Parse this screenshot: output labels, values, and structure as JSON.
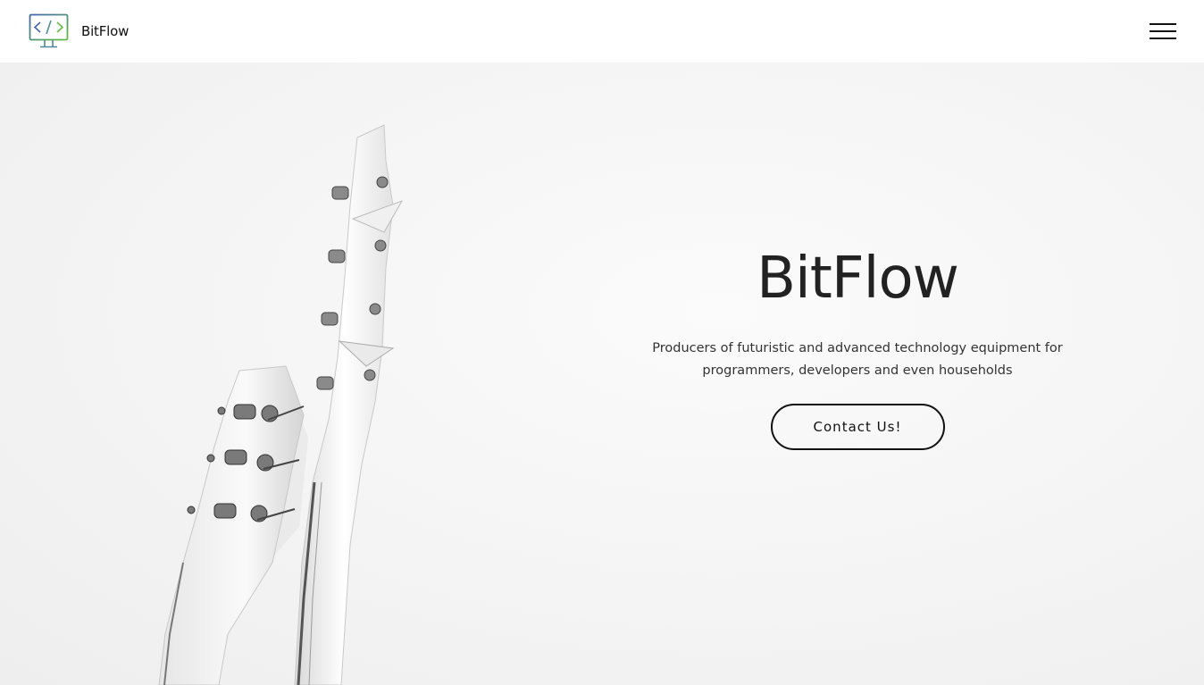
{
  "navbar": {
    "brand_name": "BitFlow",
    "logo_icon": "monitor-code-icon",
    "menu_icon": "hamburger-menu-icon"
  },
  "hero": {
    "title": "BitFlow",
    "subtitle": "Producers of futuristic and advanced technology equipment for programmers, developers and even households",
    "cta_label": "Contact Us!",
    "image_subject": "guitar-headstocks-photo"
  },
  "colors": {
    "logo_blue": "#3f64b5",
    "logo_green": "#5fbf3f",
    "text_dark": "#222222",
    "background": "#f6f6f6"
  }
}
